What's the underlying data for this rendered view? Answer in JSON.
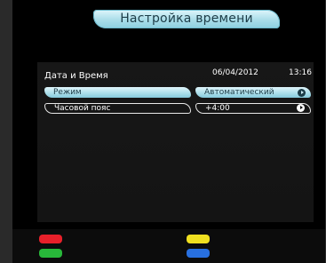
{
  "header": {
    "title": "Настройка времени"
  },
  "info": {
    "date_label": "Дата и Время",
    "date": "06/04/2012",
    "time": "13:16"
  },
  "settings": [
    {
      "label": "Режим",
      "value": "Автоматический",
      "selected": true
    },
    {
      "label": "Часовой пояс",
      "value": "+4:00",
      "selected": false
    }
  ],
  "color_keys": {
    "red": "#e8202a",
    "green": "#28b83a",
    "yellow": "#f0e020",
    "blue": "#2870e0"
  }
}
